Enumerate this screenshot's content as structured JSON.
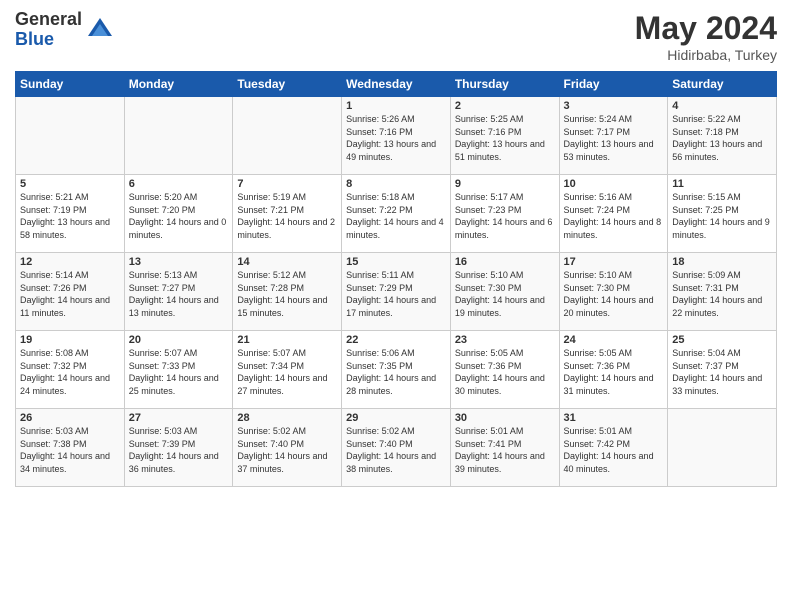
{
  "logo": {
    "general": "General",
    "blue": "Blue"
  },
  "title": {
    "month": "May 2024",
    "location": "Hidirbaba, Turkey"
  },
  "weekdays": [
    "Sunday",
    "Monday",
    "Tuesday",
    "Wednesday",
    "Thursday",
    "Friday",
    "Saturday"
  ],
  "weeks": [
    [
      {
        "day": "",
        "info": ""
      },
      {
        "day": "",
        "info": ""
      },
      {
        "day": "",
        "info": ""
      },
      {
        "day": "1",
        "info": "Sunrise: 5:26 AM\nSunset: 7:16 PM\nDaylight: 13 hours\nand 49 minutes."
      },
      {
        "day": "2",
        "info": "Sunrise: 5:25 AM\nSunset: 7:16 PM\nDaylight: 13 hours\nand 51 minutes."
      },
      {
        "day": "3",
        "info": "Sunrise: 5:24 AM\nSunset: 7:17 PM\nDaylight: 13 hours\nand 53 minutes."
      },
      {
        "day": "4",
        "info": "Sunrise: 5:22 AM\nSunset: 7:18 PM\nDaylight: 13 hours\nand 56 minutes."
      }
    ],
    [
      {
        "day": "5",
        "info": "Sunrise: 5:21 AM\nSunset: 7:19 PM\nDaylight: 13 hours\nand 58 minutes."
      },
      {
        "day": "6",
        "info": "Sunrise: 5:20 AM\nSunset: 7:20 PM\nDaylight: 14 hours\nand 0 minutes."
      },
      {
        "day": "7",
        "info": "Sunrise: 5:19 AM\nSunset: 7:21 PM\nDaylight: 14 hours\nand 2 minutes."
      },
      {
        "day": "8",
        "info": "Sunrise: 5:18 AM\nSunset: 7:22 PM\nDaylight: 14 hours\nand 4 minutes."
      },
      {
        "day": "9",
        "info": "Sunrise: 5:17 AM\nSunset: 7:23 PM\nDaylight: 14 hours\nand 6 minutes."
      },
      {
        "day": "10",
        "info": "Sunrise: 5:16 AM\nSunset: 7:24 PM\nDaylight: 14 hours\nand 8 minutes."
      },
      {
        "day": "11",
        "info": "Sunrise: 5:15 AM\nSunset: 7:25 PM\nDaylight: 14 hours\nand 9 minutes."
      }
    ],
    [
      {
        "day": "12",
        "info": "Sunrise: 5:14 AM\nSunset: 7:26 PM\nDaylight: 14 hours\nand 11 minutes."
      },
      {
        "day": "13",
        "info": "Sunrise: 5:13 AM\nSunset: 7:27 PM\nDaylight: 14 hours\nand 13 minutes."
      },
      {
        "day": "14",
        "info": "Sunrise: 5:12 AM\nSunset: 7:28 PM\nDaylight: 14 hours\nand 15 minutes."
      },
      {
        "day": "15",
        "info": "Sunrise: 5:11 AM\nSunset: 7:29 PM\nDaylight: 14 hours\nand 17 minutes."
      },
      {
        "day": "16",
        "info": "Sunrise: 5:10 AM\nSunset: 7:30 PM\nDaylight: 14 hours\nand 19 minutes."
      },
      {
        "day": "17",
        "info": "Sunrise: 5:10 AM\nSunset: 7:30 PM\nDaylight: 14 hours\nand 20 minutes."
      },
      {
        "day": "18",
        "info": "Sunrise: 5:09 AM\nSunset: 7:31 PM\nDaylight: 14 hours\nand 22 minutes."
      }
    ],
    [
      {
        "day": "19",
        "info": "Sunrise: 5:08 AM\nSunset: 7:32 PM\nDaylight: 14 hours\nand 24 minutes."
      },
      {
        "day": "20",
        "info": "Sunrise: 5:07 AM\nSunset: 7:33 PM\nDaylight: 14 hours\nand 25 minutes."
      },
      {
        "day": "21",
        "info": "Sunrise: 5:07 AM\nSunset: 7:34 PM\nDaylight: 14 hours\nand 27 minutes."
      },
      {
        "day": "22",
        "info": "Sunrise: 5:06 AM\nSunset: 7:35 PM\nDaylight: 14 hours\nand 28 minutes."
      },
      {
        "day": "23",
        "info": "Sunrise: 5:05 AM\nSunset: 7:36 PM\nDaylight: 14 hours\nand 30 minutes."
      },
      {
        "day": "24",
        "info": "Sunrise: 5:05 AM\nSunset: 7:36 PM\nDaylight: 14 hours\nand 31 minutes."
      },
      {
        "day": "25",
        "info": "Sunrise: 5:04 AM\nSunset: 7:37 PM\nDaylight: 14 hours\nand 33 minutes."
      }
    ],
    [
      {
        "day": "26",
        "info": "Sunrise: 5:03 AM\nSunset: 7:38 PM\nDaylight: 14 hours\nand 34 minutes."
      },
      {
        "day": "27",
        "info": "Sunrise: 5:03 AM\nSunset: 7:39 PM\nDaylight: 14 hours\nand 36 minutes."
      },
      {
        "day": "28",
        "info": "Sunrise: 5:02 AM\nSunset: 7:40 PM\nDaylight: 14 hours\nand 37 minutes."
      },
      {
        "day": "29",
        "info": "Sunrise: 5:02 AM\nSunset: 7:40 PM\nDaylight: 14 hours\nand 38 minutes."
      },
      {
        "day": "30",
        "info": "Sunrise: 5:01 AM\nSunset: 7:41 PM\nDaylight: 14 hours\nand 39 minutes."
      },
      {
        "day": "31",
        "info": "Sunrise: 5:01 AM\nSunset: 7:42 PM\nDaylight: 14 hours\nand 40 minutes."
      },
      {
        "day": "",
        "info": ""
      }
    ]
  ]
}
